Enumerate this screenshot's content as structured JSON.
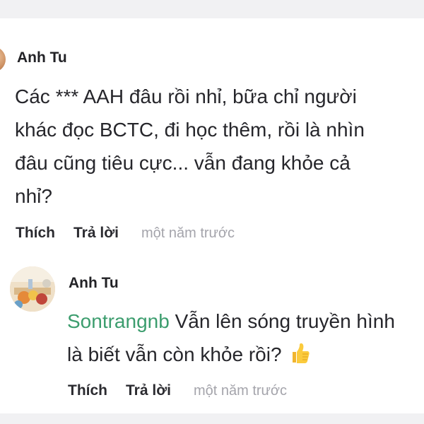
{
  "comments": [
    {
      "author": "Anh Tu",
      "lines": [
        "Các *** AAH đâu rồi nhỉ, bữa chỉ người",
        "khác đọc BCTC, đi học thêm, rồi là nhìn",
        "đâu cũng tiêu cực... vẫn đang khỏe cả",
        "nhỉ?"
      ],
      "like_label": "Thích",
      "reply_label": "Trả lời",
      "time": "một năm trước"
    }
  ],
  "reply": {
    "author": "Anh Tu",
    "mention": "Sontrangnb",
    "line1_rest": " Vẫn lên sóng truyền hình",
    "line2": "là biết vẫn còn khỏe rồi?",
    "emoji_icon": "thumbs-up-icon",
    "like_label": "Thích",
    "reply_label": "Trả lời",
    "time": "một năm trước"
  },
  "colors": {
    "mention": "#3c9d6e",
    "text": "#26262b",
    "muted": "#a4a4ab",
    "strip": "#f1f1f3"
  }
}
